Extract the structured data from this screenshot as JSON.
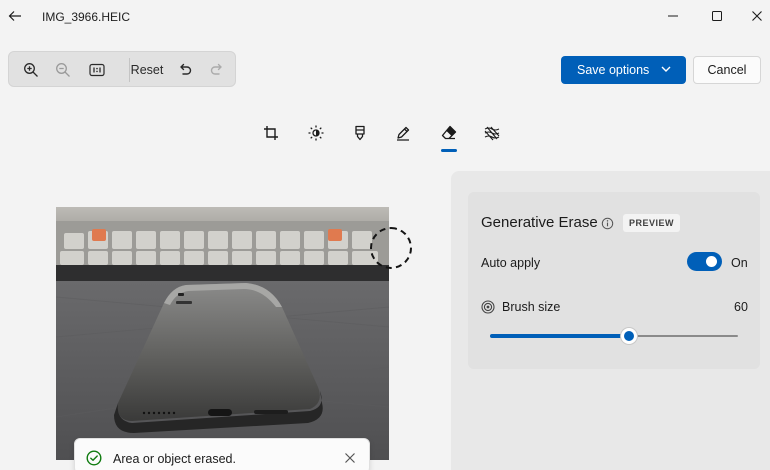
{
  "window": {
    "title": "IMG_3966.HEIC"
  },
  "toolbar": {
    "reset_label": "Reset"
  },
  "actions": {
    "save_label": "Save options",
    "cancel_label": "Cancel"
  },
  "edit_tools": [
    {
      "icon": "crop-icon"
    },
    {
      "icon": "brightness-icon"
    },
    {
      "icon": "filter-icon"
    },
    {
      "icon": "markup-pen-icon"
    },
    {
      "icon": "eraser-icon",
      "active": true
    },
    {
      "icon": "background-icon"
    }
  ],
  "panel": {
    "title": "Generative Erase",
    "badge": "PREVIEW",
    "auto_apply_label": "Auto apply",
    "auto_apply_on": true,
    "auto_apply_state": "On",
    "brush_label": "Brush size",
    "brush_value": "60",
    "brush_fraction": 0.56
  },
  "toast": {
    "message": "Area or object erased."
  },
  "colors": {
    "accent": "#005fb8",
    "success": "#0f7b0f"
  }
}
